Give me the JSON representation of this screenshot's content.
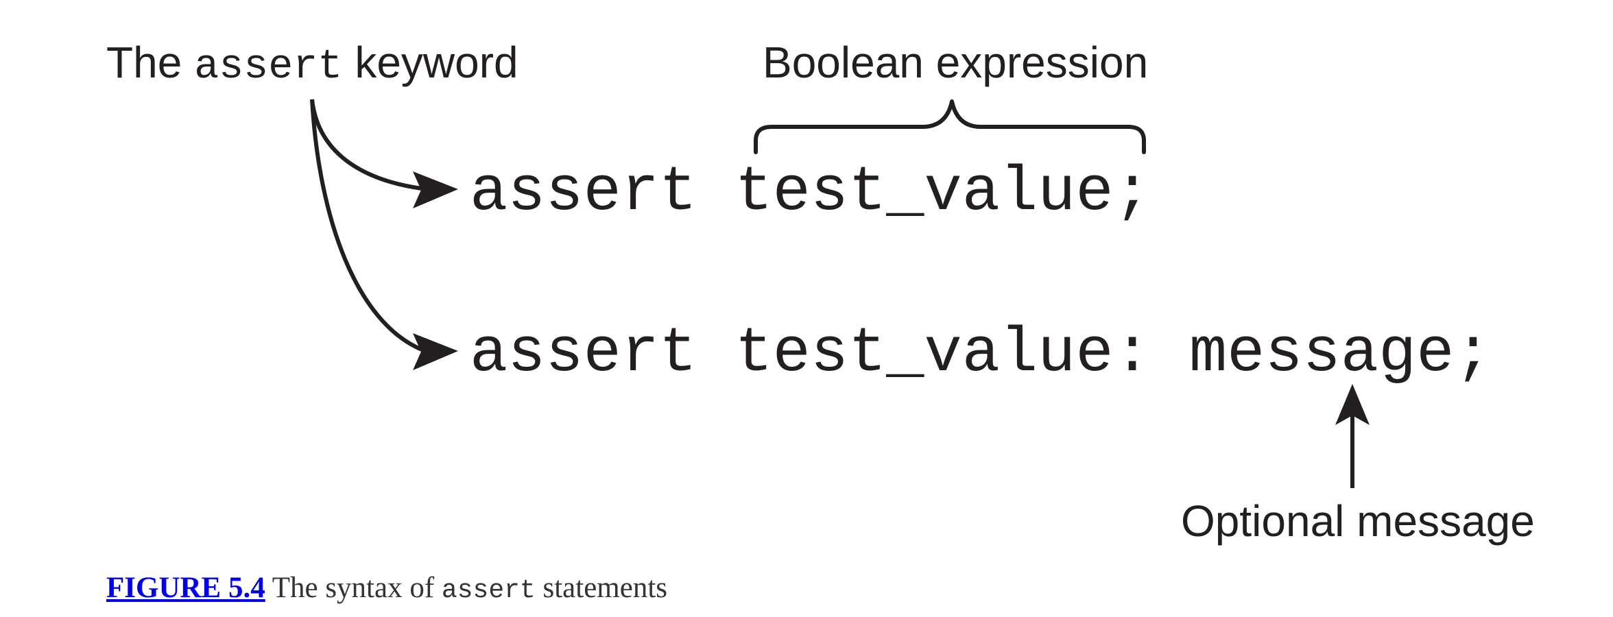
{
  "labels": {
    "keyword_prefix": "The",
    "keyword_code": "assert",
    "keyword_suffix": "keyword",
    "boolean_expression": "Boolean expression",
    "optional_message": "Optional message"
  },
  "code": {
    "line1": "assert test_value;",
    "line2": "assert test_value: message;"
  },
  "caption": {
    "link": "FIGURE 5.4",
    "text_before": "The syntax of",
    "code": "assert",
    "text_after": "statements"
  },
  "colors": {
    "ink": "#231f20",
    "link": "#0000ee",
    "caption_text": "#333333"
  }
}
